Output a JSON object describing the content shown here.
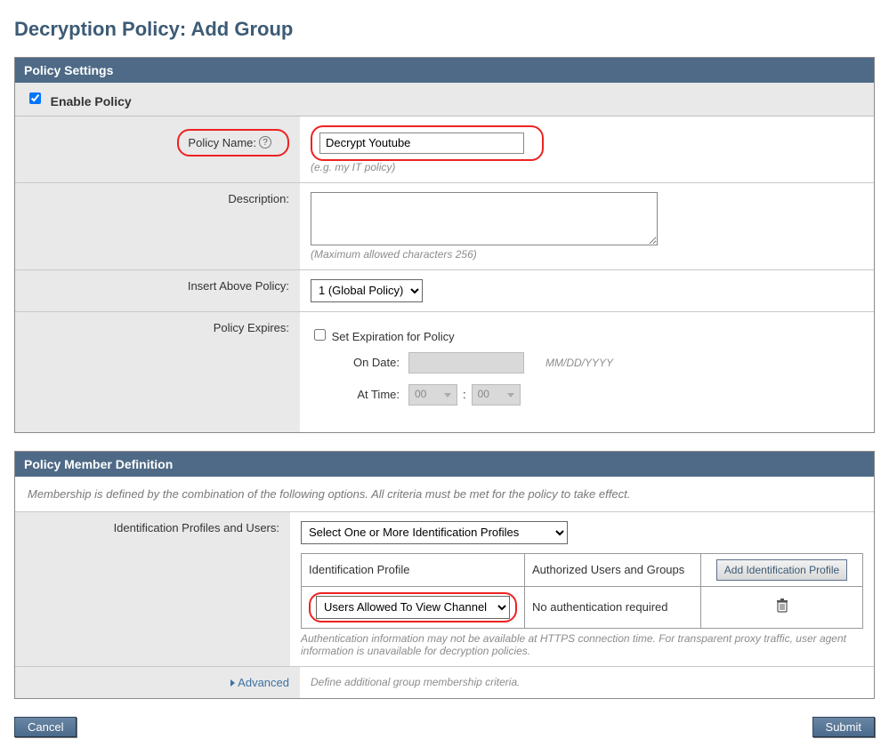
{
  "page": {
    "title": "Decryption Policy: Add Group"
  },
  "policySettings": {
    "sectionTitle": "Policy Settings",
    "enable": {
      "label": "Enable Policy",
      "checked": true
    },
    "policyName": {
      "label": "Policy Name:",
      "value": "Decrypt Youtube",
      "hint": "(e.g. my IT policy)"
    },
    "description": {
      "label": "Description:",
      "value": "",
      "hint": "(Maximum allowed characters 256)"
    },
    "insertAbove": {
      "label": "Insert Above Policy:",
      "selected": "1 (Global Policy)"
    },
    "expires": {
      "label": "Policy Expires:",
      "setExpiration": {
        "label": "Set Expiration for Policy",
        "checked": false
      },
      "onDate": {
        "label": "On Date:",
        "placeholder": "MM/DD/YYYY"
      },
      "atTime": {
        "label": "At Time:",
        "hour": "00",
        "minute": "00"
      }
    }
  },
  "memberDefinition": {
    "sectionTitle": "Policy Member Definition",
    "intro": "Membership is defined by the combination of the following options. All criteria must be met for the policy to take effect.",
    "profilesUsers": {
      "label": "Identification Profiles and Users:",
      "selected": "Select One or More Identification Profiles",
      "table": {
        "headers": [
          "Identification Profile",
          "Authorized Users and Groups",
          ""
        ],
        "addButton": "Add Identification Profile",
        "rows": [
          {
            "profileSelected": "Users Allowed To View Channel",
            "authText": "No authentication required"
          }
        ]
      },
      "note": "Authentication information may not be available at HTTPS connection time. For transparent proxy traffic, user agent information is unavailable for decryption policies."
    },
    "advanced": {
      "link": "Advanced",
      "text": "Define additional group membership criteria."
    }
  },
  "footer": {
    "cancel": "Cancel",
    "submit": "Submit"
  }
}
